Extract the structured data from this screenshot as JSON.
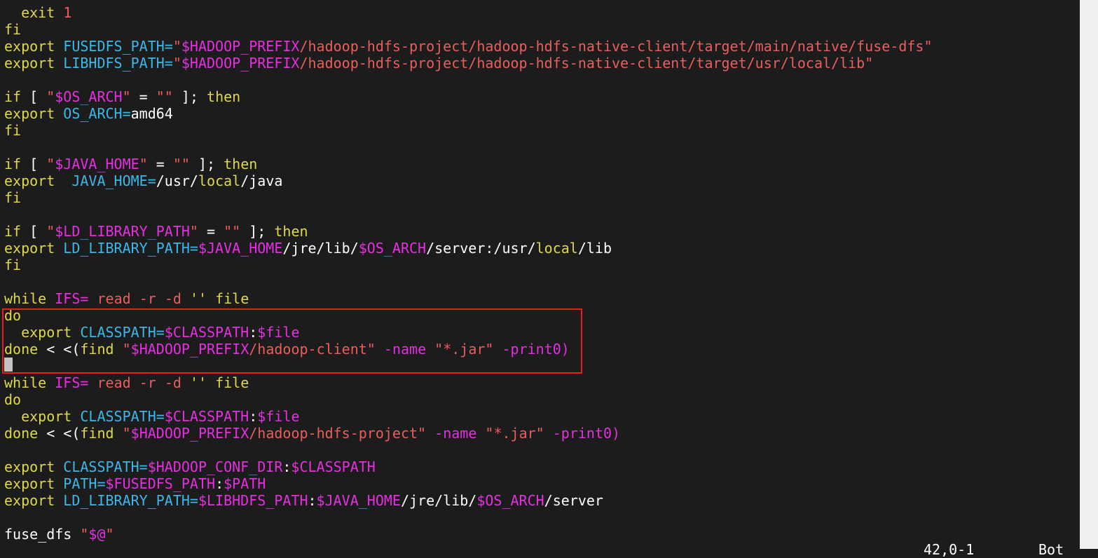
{
  "editor": {
    "lines": [
      [
        [
          "  ",
          "plain"
        ],
        [
          "exit",
          "kw"
        ],
        [
          " ",
          "plain"
        ],
        [
          "1",
          "str"
        ]
      ],
      [
        [
          "fi",
          "kw"
        ]
      ],
      [
        [
          "export",
          "kw"
        ],
        [
          " ",
          "plain"
        ],
        [
          "FUSEDFS_PATH=",
          "ident"
        ],
        [
          "\"",
          "str"
        ],
        [
          "$HADOOP_PREFIX",
          "var"
        ],
        [
          "/hadoop-hdfs-project/hadoop-hdfs-native-client/target/main/native/fuse-dfs\"",
          "str"
        ]
      ],
      [
        [
          "export",
          "kw"
        ],
        [
          " ",
          "plain"
        ],
        [
          "LIBHDFS_PATH=",
          "ident"
        ],
        [
          "\"",
          "str"
        ],
        [
          "$HADOOP_PREFIX",
          "var"
        ],
        [
          "/hadoop-hdfs-project/hadoop-hdfs-native-client/target/usr/local/lib\"",
          "str"
        ]
      ],
      [],
      [
        [
          "if",
          "kw"
        ],
        [
          " [ ",
          "plain"
        ],
        [
          "\"",
          "str"
        ],
        [
          "$OS_ARCH",
          "var"
        ],
        [
          "\"",
          "str"
        ],
        [
          " = ",
          "plain"
        ],
        [
          "\"\"",
          "str"
        ],
        [
          " ]; ",
          "plain"
        ],
        [
          "then",
          "kw"
        ]
      ],
      [
        [
          "export",
          "kw"
        ],
        [
          " ",
          "plain"
        ],
        [
          "OS_ARCH=",
          "ident"
        ],
        [
          "amd64",
          "plain"
        ]
      ],
      [
        [
          "fi",
          "kw"
        ]
      ],
      [],
      [
        [
          "if",
          "kw"
        ],
        [
          " [ ",
          "plain"
        ],
        [
          "\"",
          "str"
        ],
        [
          "$JAVA_HOME",
          "var"
        ],
        [
          "\"",
          "str"
        ],
        [
          " = ",
          "plain"
        ],
        [
          "\"\"",
          "str"
        ],
        [
          " ]; ",
          "plain"
        ],
        [
          "then",
          "kw"
        ]
      ],
      [
        [
          "export",
          "kw"
        ],
        [
          "  ",
          "plain"
        ],
        [
          "JAVA_HOME=",
          "ident"
        ],
        [
          "/usr/",
          "plain"
        ],
        [
          "local",
          "kw"
        ],
        [
          "/java",
          "plain"
        ]
      ],
      [
        [
          "fi",
          "kw"
        ]
      ],
      [],
      [
        [
          "if",
          "kw"
        ],
        [
          " [ ",
          "plain"
        ],
        [
          "\"",
          "str"
        ],
        [
          "$LD_LIBRARY_PATH",
          "var"
        ],
        [
          "\"",
          "str"
        ],
        [
          " = ",
          "plain"
        ],
        [
          "\"\"",
          "str"
        ],
        [
          " ]; ",
          "plain"
        ],
        [
          "then",
          "kw"
        ]
      ],
      [
        [
          "export",
          "kw"
        ],
        [
          " ",
          "plain"
        ],
        [
          "LD_LIBRARY_PATH=",
          "ident"
        ],
        [
          "$JAVA_HOME",
          "var"
        ],
        [
          "/jre/lib/",
          "plain"
        ],
        [
          "$OS_ARCH",
          "var"
        ],
        [
          "/server:/usr/",
          "plain"
        ],
        [
          "local",
          "kw"
        ],
        [
          "/lib",
          "plain"
        ]
      ],
      [
        [
          "fi",
          "kw"
        ]
      ],
      [],
      [
        [
          "while",
          "kw"
        ],
        [
          " ",
          "plain"
        ],
        [
          "IFS=",
          "var"
        ],
        [
          " ",
          "plain"
        ],
        [
          "read -r -d",
          "str"
        ],
        [
          " ",
          "plain"
        ],
        [
          "''",
          "kw"
        ],
        [
          " ",
          "plain"
        ],
        [
          "file",
          "kw"
        ]
      ],
      [
        [
          "do",
          "kw"
        ]
      ],
      [
        [
          "  ",
          "plain"
        ],
        [
          "export",
          "kw"
        ],
        [
          " ",
          "plain"
        ],
        [
          "CLASSPATH=",
          "ident"
        ],
        [
          "$CLASSPATH",
          "var"
        ],
        [
          ":",
          "plain"
        ],
        [
          "$file",
          "var"
        ]
      ],
      [
        [
          "done",
          "kw"
        ],
        [
          " < <(",
          "plain"
        ],
        [
          "find",
          "kw"
        ],
        [
          " ",
          "plain"
        ],
        [
          "\"",
          "str"
        ],
        [
          "$HADOOP_PREFIX",
          "var"
        ],
        [
          "/hadoop-client\"",
          "str"
        ],
        [
          " ",
          "plain"
        ],
        [
          "-name",
          "var"
        ],
        [
          " ",
          "plain"
        ],
        [
          "\"*.jar\"",
          "str"
        ],
        [
          " ",
          "plain"
        ],
        [
          "-print0)",
          "var"
        ]
      ],
      [],
      [
        [
          "while",
          "kw"
        ],
        [
          " ",
          "plain"
        ],
        [
          "IFS=",
          "var"
        ],
        [
          " ",
          "plain"
        ],
        [
          "read -r -d",
          "str"
        ],
        [
          " ",
          "plain"
        ],
        [
          "''",
          "kw"
        ],
        [
          " ",
          "plain"
        ],
        [
          "file",
          "kw"
        ]
      ],
      [
        [
          "do",
          "kw"
        ]
      ],
      [
        [
          "  ",
          "plain"
        ],
        [
          "export",
          "kw"
        ],
        [
          " ",
          "plain"
        ],
        [
          "CLASSPATH=",
          "ident"
        ],
        [
          "$CLASSPATH",
          "var"
        ],
        [
          ":",
          "plain"
        ],
        [
          "$file",
          "var"
        ]
      ],
      [
        [
          "done",
          "kw"
        ],
        [
          " < <(",
          "plain"
        ],
        [
          "find",
          "kw"
        ],
        [
          " ",
          "plain"
        ],
        [
          "\"",
          "str"
        ],
        [
          "$HADOOP_PREFIX",
          "var"
        ],
        [
          "/hadoop-hdfs-project\"",
          "str"
        ],
        [
          " ",
          "plain"
        ],
        [
          "-name",
          "var"
        ],
        [
          " ",
          "plain"
        ],
        [
          "\"*.jar\"",
          "str"
        ],
        [
          " ",
          "plain"
        ],
        [
          "-print0)",
          "var"
        ]
      ],
      [],
      [
        [
          "export",
          "kw"
        ],
        [
          " ",
          "plain"
        ],
        [
          "CLASSPATH=",
          "ident"
        ],
        [
          "$HADOOP_CONF_DIR",
          "var"
        ],
        [
          ":",
          "plain"
        ],
        [
          "$CLASSPATH",
          "var"
        ]
      ],
      [
        [
          "export",
          "kw"
        ],
        [
          " ",
          "plain"
        ],
        [
          "PATH=",
          "ident"
        ],
        [
          "$FUSEDFS_PATH",
          "var"
        ],
        [
          ":",
          "plain"
        ],
        [
          "$PATH",
          "var"
        ]
      ],
      [
        [
          "export",
          "kw"
        ],
        [
          " ",
          "plain"
        ],
        [
          "LD_LIBRARY_PATH=",
          "ident"
        ],
        [
          "$LIBHDFS_PATH",
          "var"
        ],
        [
          ":",
          "plain"
        ],
        [
          "$JAVA_HOME",
          "var"
        ],
        [
          "/jre/lib/",
          "plain"
        ],
        [
          "$OS_ARCH",
          "var"
        ],
        [
          "/server",
          "plain"
        ]
      ],
      [],
      [
        [
          "fuse_dfs",
          "plain"
        ],
        [
          " ",
          "plain"
        ],
        [
          "\"",
          "str"
        ],
        [
          "$@",
          "var"
        ],
        [
          "\"",
          "str"
        ]
      ]
    ],
    "colors": {
      "background": "#1c1c1c",
      "plain": "#ffffff",
      "keyword": "#e0d84a",
      "variable": "#e52fe0",
      "identifier": "#3bb8e8",
      "string": "#ee5c5c",
      "highlight_box": "#e61e1e"
    }
  },
  "status": {
    "ruler": "42,0-1",
    "position": "Bot"
  }
}
